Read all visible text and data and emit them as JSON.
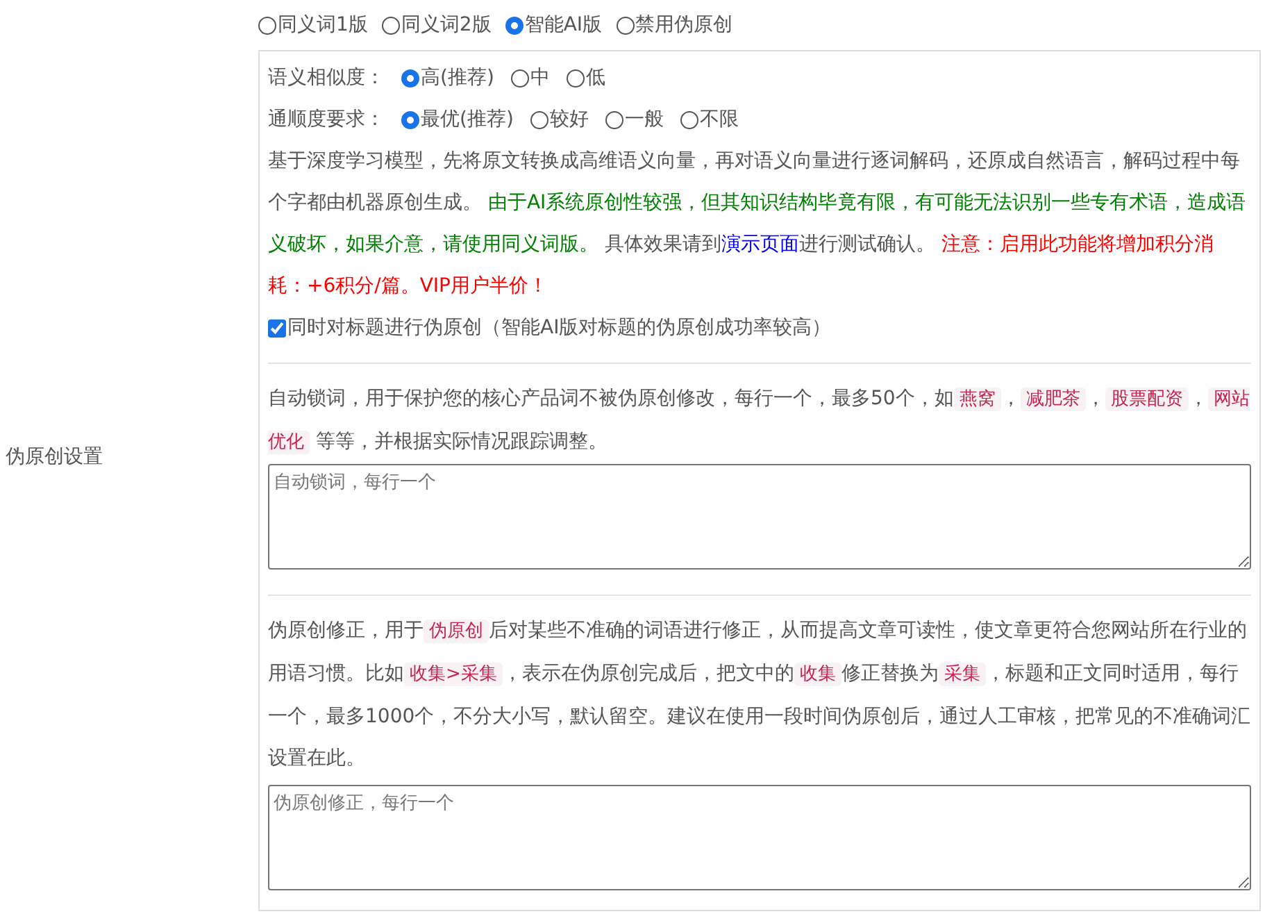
{
  "section_label": "伪原创设置",
  "modes": [
    {
      "label": "同义词1版",
      "selected": false
    },
    {
      "label": "同义词2版",
      "selected": false
    },
    {
      "label": "智能AI版",
      "selected": true
    },
    {
      "label": "禁用伪原创",
      "selected": false
    }
  ],
  "ai_settings": {
    "similarity": {
      "label": "语义相似度：",
      "options": [
        {
          "label": "高(推荐)",
          "selected": true
        },
        {
          "label": "中",
          "selected": false
        },
        {
          "label": "低",
          "selected": false
        }
      ]
    },
    "fluency": {
      "label": "通顺度要求：",
      "options": [
        {
          "label": "最优(推荐)",
          "selected": true
        },
        {
          "label": "较好",
          "selected": false
        },
        {
          "label": "一般",
          "selected": false
        },
        {
          "label": "不限",
          "selected": false
        }
      ]
    },
    "description": [
      {
        "kind": "plain",
        "text": "基于深度学习模型，先将原文转换成高维语义向量，再对语义向量进行逐词解码，还原成自然语言，解码过程中每个字都由机器原创生成。 "
      },
      {
        "kind": "note",
        "text": "由于AI系统原创性较强，但其知识结构毕竟有限，有可能无法识别一些专有术语，造成语义破坏，如果介意，请使用同义词版。"
      },
      {
        "kind": "plain",
        "text": " 具体效果请到"
      },
      {
        "kind": "link",
        "text": "演示页面"
      },
      {
        "kind": "plain",
        "text": "进行测试确认。 "
      },
      {
        "kind": "warning",
        "text": "注意：启用此功能将增加积分消耗：+6积分/篇。VIP用户半价！"
      }
    ],
    "title_option": {
      "label": "同时对标题进行伪原创（智能AI版对标题的伪原创成功率较高）",
      "checked": true
    }
  },
  "lock_words": {
    "description": [
      {
        "kind": "plain",
        "text": "自动锁词，用于保护您的核心产品词不被伪原创修改，每行一个，最多50个，如"
      },
      {
        "kind": "tag",
        "text": "燕窝"
      },
      {
        "kind": "plain",
        "text": "，"
      },
      {
        "kind": "tag",
        "text": "减肥茶"
      },
      {
        "kind": "plain",
        "text": "，"
      },
      {
        "kind": "tag",
        "text": "股票配资"
      },
      {
        "kind": "plain",
        "text": "，"
      },
      {
        "kind": "tag",
        "text": "网站优化"
      },
      {
        "kind": "plain",
        "text": " 等等，并根据实际情况跟踪调整。"
      }
    ],
    "placeholder": "自动锁词，每行一个"
  },
  "corrections": {
    "description": [
      {
        "kind": "plain",
        "text": "伪原创修正，用于"
      },
      {
        "kind": "tag",
        "text": "伪原创"
      },
      {
        "kind": "plain",
        "text": "后对某些不准确的词语进行修正，从而提高文章可读性，使文章更符合您网站所在行业的用语习惯。比如"
      },
      {
        "kind": "tag",
        "text": "收集>采集"
      },
      {
        "kind": "plain",
        "text": "，表示在伪原创完成后，把文中的"
      },
      {
        "kind": "tag",
        "text": "收集"
      },
      {
        "kind": "plain",
        "text": "修正替换为"
      },
      {
        "kind": "tag",
        "text": "采集"
      },
      {
        "kind": "plain",
        "text": "，标题和正文同时适用，每行一个，最多1000个，不分大小写，默认留空。建议在使用一段时间伪原创后，通过人工审核，把常见的不准确词汇设置在此。"
      }
    ],
    "placeholder": "伪原创修正，每行一个"
  }
}
